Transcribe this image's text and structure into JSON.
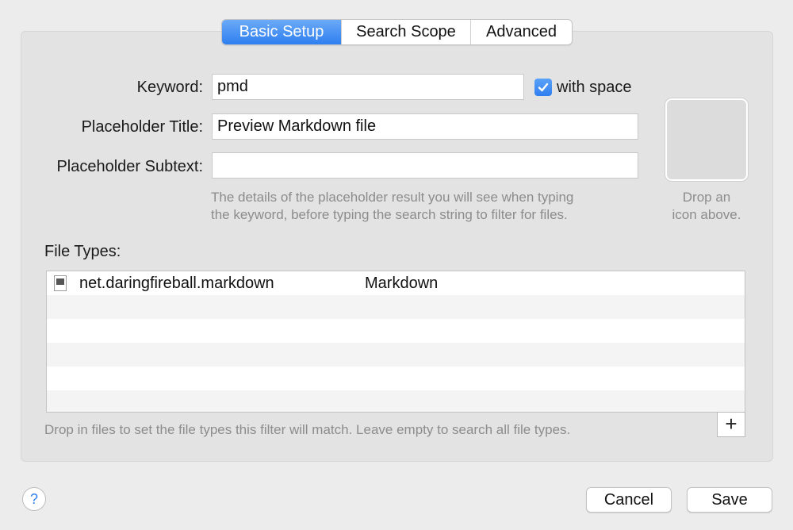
{
  "tabs": [
    {
      "label": "Basic Setup",
      "active": true
    },
    {
      "label": "Search Scope",
      "active": false
    },
    {
      "label": "Advanced",
      "active": false
    }
  ],
  "form": {
    "keyword_label": "Keyword:",
    "keyword_value": "pmd",
    "with_space_label": "with space",
    "with_space_checked": true,
    "title_label": "Placeholder Title:",
    "title_value": "Preview Markdown file",
    "subtext_label": "Placeholder Subtext:",
    "subtext_value": "",
    "hint_line1": "The details of the placeholder result you will see when typing",
    "hint_line2": "the keyword, before typing the search string to filter for files."
  },
  "icon_well": {
    "line1": "Drop an",
    "line2": "icon above."
  },
  "file_types": {
    "label": "File Types:",
    "rows": [
      {
        "uti": "net.daringfireball.markdown",
        "name": "Markdown",
        "icon": "markdown-file-icon"
      }
    ],
    "hint": "Drop in files to set the file types this filter will match. Leave empty to search all file types.",
    "add_label": "+"
  },
  "footer": {
    "help_label": "?",
    "cancel_label": "Cancel",
    "save_label": "Save"
  },
  "colors": {
    "accent": "#2f7ff0",
    "panel": "#e3e3e3",
    "background": "#ececec"
  }
}
